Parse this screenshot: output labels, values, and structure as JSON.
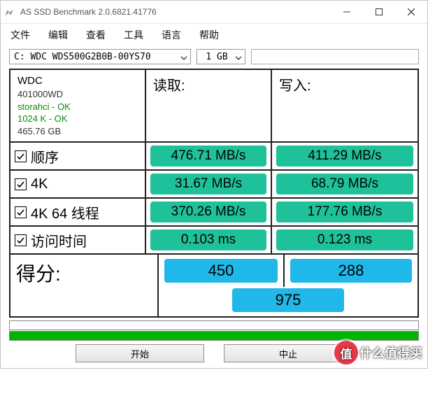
{
  "window": {
    "title": "AS SSD Benchmark 2.0.6821.41776"
  },
  "menu": {
    "file": "文件",
    "edit": "编辑",
    "view": "查看",
    "tools": "工具",
    "language": "语言",
    "help": "帮助"
  },
  "selectors": {
    "drive": "C: WDC  WDS500G2B0B-00YS70",
    "size": "1 GB"
  },
  "drive_info": {
    "model": "WDC",
    "firmware": "401000WD",
    "driver_status": "storahci - OK",
    "alignment_status": "1024 K - OK",
    "capacity": "465.76 GB"
  },
  "headers": {
    "read": "读取:",
    "write": "写入:"
  },
  "tests": {
    "seq": {
      "label": "顺序",
      "checked": true,
      "read": "476.71 MB/s",
      "write": "411.29 MB/s"
    },
    "fourk": {
      "label": "4K",
      "checked": true,
      "read": "31.67 MB/s",
      "write": "68.79 MB/s"
    },
    "fourk64": {
      "label": "4K 64 线程",
      "checked": true,
      "read": "370.26 MB/s",
      "write": "177.76 MB/s"
    },
    "access": {
      "label": "访问时间",
      "checked": true,
      "read": "0.103 ms",
      "write": "0.123 ms"
    }
  },
  "score": {
    "label": "得分:",
    "read": "450",
    "write": "288",
    "total": "975"
  },
  "buttons": {
    "start": "开始",
    "abort": "中止"
  },
  "watermark": {
    "badge": "值",
    "text": "什么值得买"
  }
}
